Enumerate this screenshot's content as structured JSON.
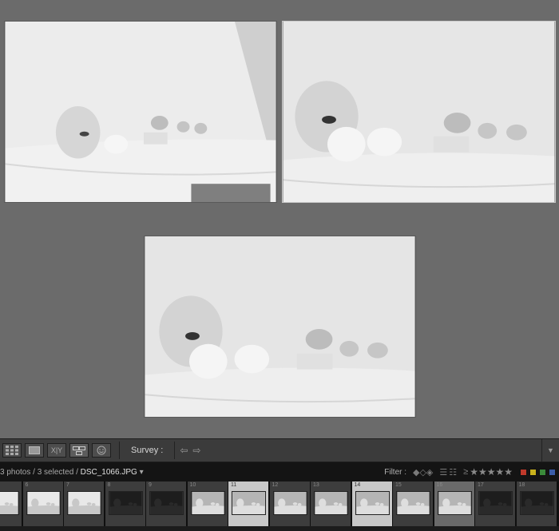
{
  "toolbar": {
    "survey_label": "Survey :",
    "buttons": [
      "grid-view",
      "loupe-view",
      "compare-view",
      "survey-view",
      "people-view"
    ],
    "compare_label": "X|Y"
  },
  "filmstrip_header": {
    "count_text": "3 photos / 3 selected / ",
    "filename": "DSC_1066.JPG",
    "dropdown_glyph": "▾",
    "filter_label": "Filter :",
    "stars": "★★★★★",
    "color_labels": [
      "#c0392b",
      "#c9b21d",
      "#3a8a3a",
      "#3b5da8"
    ]
  },
  "filmstrip": {
    "cells": [
      {
        "num": "",
        "tone": "white",
        "state": "normal"
      },
      {
        "num": "6",
        "tone": "white",
        "state": "normal"
      },
      {
        "num": "7",
        "tone": "white",
        "state": "normal"
      },
      {
        "num": "8",
        "tone": "dark",
        "state": "normal"
      },
      {
        "num": "9",
        "tone": "dark",
        "state": "normal"
      },
      {
        "num": "10",
        "tone": "gray",
        "state": "normal"
      },
      {
        "num": "11",
        "tone": "gray",
        "state": "active"
      },
      {
        "num": "12",
        "tone": "gray",
        "state": "normal"
      },
      {
        "num": "13",
        "tone": "gray",
        "state": "normal"
      },
      {
        "num": "14",
        "tone": "gray",
        "state": "active"
      },
      {
        "num": "15",
        "tone": "gray",
        "state": "normal"
      },
      {
        "num": "16",
        "tone": "gray",
        "state": "selected"
      },
      {
        "num": "17",
        "tone": "dark",
        "state": "normal"
      },
      {
        "num": "18",
        "tone": "dark",
        "state": "normal"
      }
    ]
  },
  "colors": {
    "panel_bg": "#6b6b6b",
    "toolbar_bg": "#3b3b3b",
    "filmstrip_bg": "#0f0f0f"
  }
}
